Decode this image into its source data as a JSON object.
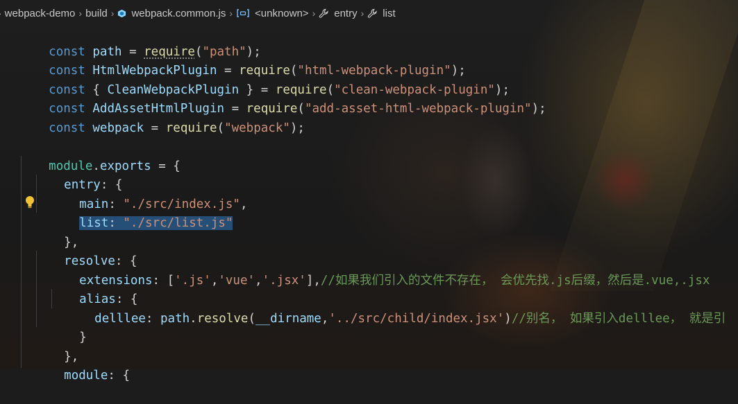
{
  "breadcrumb": {
    "items": [
      {
        "label": "webpack-demo",
        "icon": ""
      },
      {
        "label": "build",
        "icon": ""
      },
      {
        "label": "webpack.common.js",
        "icon": "webpack-cube-icon"
      },
      {
        "label": "<unknown>",
        "icon": "variable-brackets-icon"
      },
      {
        "label": "entry",
        "icon": "wrench-icon"
      },
      {
        "label": "list",
        "icon": "wrench-icon"
      }
    ],
    "leading_glyph": "›",
    "separator": "›"
  },
  "code": {
    "l1": {
      "a": "const ",
      "b": "path",
      "c": " = ",
      "d": "require",
      "e": "(",
      "f": "\"path\"",
      "g": ");"
    },
    "l2": {
      "a": "const ",
      "b": "HtmlWebpackPlugin",
      "c": " = ",
      "d": "require",
      "e": "(",
      "f": "\"html-webpack-plugin\"",
      "g": ");"
    },
    "l3": {
      "a": "const ",
      "b": "{ ",
      "c": "CleanWebpackPlugin",
      "d": " } = ",
      "e": "require",
      "f": "(",
      "g": "\"clean-webpack-plugin\"",
      "h": ");"
    },
    "l4": {
      "a": "const ",
      "b": "AddAssetHtmlPlugin",
      "c": " = ",
      "d": "require",
      "e": "(",
      "f": "\"add-asset-html-webpack-plugin\"",
      "g": ");"
    },
    "l5": {
      "a": "const ",
      "b": "webpack",
      "c": " = ",
      "d": "require",
      "e": "(",
      "f": "\"webpack\"",
      "g": ");"
    },
    "l7": {
      "a": "module",
      "b": ".",
      "c": "exports",
      "d": " = {"
    },
    "l8": {
      "a": "entry",
      "b": ": {"
    },
    "l9": {
      "a": "main",
      "b": ": ",
      "c": "\"./src/index.js\"",
      "d": ","
    },
    "l10": {
      "a": "list",
      "b": ": ",
      "c": "\"./src/list.js\""
    },
    "l11": {
      "a": "},"
    },
    "l12": {
      "a": "resolve",
      "b": ": {"
    },
    "l13": {
      "a": "extensions",
      "b": ": [",
      "c": "'.js'",
      "d": ",",
      "e": "'vue'",
      "f": ",",
      "g": "'.jsx'",
      "h": "],",
      "i": "//如果我们引入的文件不存在， 会优先找.js后缀，然后是.vue,.jsx"
    },
    "l14": {
      "a": "alias",
      "b": ": {"
    },
    "l15": {
      "a": "delllee",
      "b": ": ",
      "c": "path",
      "d": ".",
      "e": "resolve",
      "f": "(",
      "g": "__dirname",
      "h": ",",
      "i": "'../src/child/index.jsx'",
      "j": ")",
      "k": "//别名， 如果引入delllee， 就是引"
    },
    "l16": {
      "a": "}"
    },
    "l17": {
      "a": "},"
    },
    "l18": {
      "a": "module",
      "b": ": {"
    }
  },
  "colors": {
    "keyword": "#569cd6",
    "variable": "#9cdcfe",
    "function": "#dcdcaa",
    "string": "#ce9178",
    "comment": "#6a9955",
    "selection": "#264f78"
  }
}
